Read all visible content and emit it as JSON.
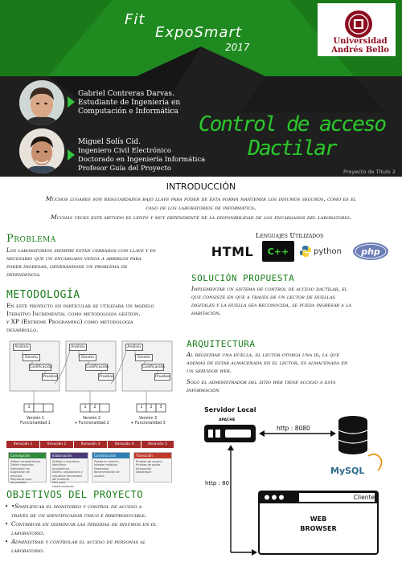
{
  "header": {
    "fit": "Fit",
    "expo": "ExpoSmart",
    "year": "2017",
    "university": [
      "Universidad",
      "Andrés Bello"
    ],
    "people": [
      {
        "lines": [
          "Gabriel Contreras Darvas.",
          "Estudiante de Ingeniería en",
          "Computación e Informática"
        ]
      },
      {
        "lines": [
          "Miguel Solís Cid.",
          "Ingeniero Civil Electrónico",
          "Doctorado en Ingeniería Informática",
          "Profesor Guía del Proyecto"
        ]
      }
    ],
    "project_title": [
      "Control de acceso",
      "Dactilar"
    ],
    "subtitle": "Proyecto de Título 2"
  },
  "intro": {
    "title": "INTRODUCCIÓN",
    "lines": [
      "Muchos lugares son resguardados bajo llave para poder de esta forma mantener los insumos seguros, como es el",
      "caso de los laboratorios de informática.",
      "Muchas veces este método es lento y muy dependiente de la disponibilidad de los encargados del laboratorio."
    ]
  },
  "problema": {
    "title": "Problema",
    "lines": [
      "Los laboratorios siempre están cerrados con llave y es",
      "necesario que un encargado venga a abrirlos para",
      "poder ingresar, generándose un problema de",
      "dependencia."
    ]
  },
  "lenguajes": {
    "title": "Lenguajes Utilizados",
    "items": [
      "HTML",
      "C++",
      "python",
      "php"
    ]
  },
  "solucion": {
    "title": "SOLUCIÓN PROPUESTA",
    "lines": [
      "Implementar un sistema de control de acceso dactilar, el",
      "que consiste en que a través de un lector de huellas",
      "digitales y la huella sea reconocida, se pueda ingresar a la",
      "habitación."
    ]
  },
  "metodologia": {
    "title": "METODOLOGÍA",
    "lines": [
      "En este proyecto en particular se utilizará un modelo",
      "Iterativo Incremental como metodología gestión.",
      "y XP (Extreme Programing) como metodología",
      "desarrollo."
    ],
    "diagram": {
      "stages": [
        "Análisis",
        "Diseño",
        "Codificación",
        "Pruebas"
      ],
      "versions": [
        {
          "label": "Versión 1",
          "sub": "Funcionalidad 1",
          "cells": [
            "1",
            "",
            ""
          ]
        },
        {
          "label": "Versión 2",
          "sub": "+ Funcionalidad 2",
          "cells": [
            "1",
            "2",
            ""
          ]
        },
        {
          "label": "Versión 3",
          "sub": "+ Funcionalidad 3",
          "cells": [
            "1",
            "2",
            "3"
          ]
        }
      ],
      "iterations": [
        "Iteración 1",
        "Iteración 2",
        "Iteración 3",
        "Iteración 4",
        "Iteración 5"
      ],
      "phases": [
        {
          "name": "Concepción",
          "items": [
            "Definir características",
            "Definir requisitos",
            "Estimación de",
            "Asignación de",
            "recursos",
            "Requisitos para",
            "las pruebas"
          ]
        },
        {
          "name": "Elaboración",
          "items": [
            "Análisis y requisitos",
            "Identificar",
            "Arquitectura",
            "Diseño, arquitectura y",
            "requisitos funcionales",
            "del producto",
            "Plan para",
            "implementación"
          ]
        },
        {
          "name": "Construcción",
          "items": [
            "Puesta en marcha",
            "Integrar módulos",
            "Desarrollar",
            "documentación de",
            "usuario"
          ]
        },
        {
          "name": "Transición",
          "items": [
            "Pruebas de usuario",
            "Pruebas de ajuste",
            "Integración",
            "Despliegue"
          ]
        }
      ]
    }
  },
  "objetivos": {
    "title": "OBJETIVOS DEL PROYECTO",
    "items": [
      [
        "•Simplificar el monitoreo y control de acceso a",
        "través de un identificador único e irreproducible."
      ],
      [
        "Contribuir en disminuir las pérdidas de insumos en el laboratorio.",
        ""
      ],
      [
        "Administrar y controlar el acceso de personas al",
        "laboratorio."
      ]
    ]
  },
  "arquitectura": {
    "title": "ARQUITECTURA",
    "lines": [
      "Al registrar una huella, el lector otorga una id, la que",
      "además de estar almacenada en el lector, es almacenada en",
      "un servidor web.",
      "Solo el administrador del sitio web tiene acceso a esta",
      "información"
    ],
    "diagram": {
      "server_label": "Servidor Local",
      "apache": "APACHE",
      "http_8080": "http : 8080",
      "http_80": "http : 80",
      "client": "Cliente",
      "web": "WEB",
      "browser": "BROWSER",
      "mysql": "MySQL"
    }
  },
  "colors": {
    "header_bg": "#1f1f1f",
    "header_green": "#1f8a1f",
    "accent_green": "#2ec42f",
    "heading_green": "#1a7c1a",
    "univ_red": "#8b0d1f",
    "iteration_red": "#a52a2a",
    "phase_green": "#2e8b3a",
    "phase_purple": "#4a3a7a",
    "phase_blue": "#2f7fb5",
    "phase_red": "#c0392b"
  }
}
